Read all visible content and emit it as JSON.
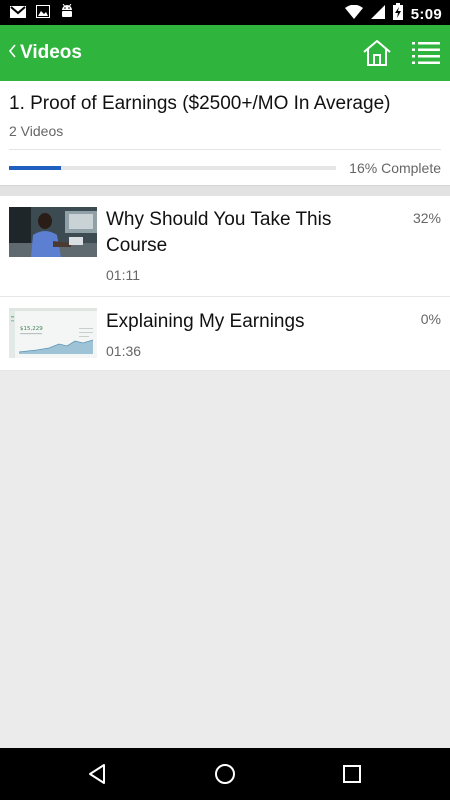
{
  "status_bar": {
    "time": "5:09",
    "icons": [
      "gmail-icon",
      "image-icon",
      "android-icon",
      "wifi-icon",
      "signal-icon",
      "battery-charging-icon"
    ]
  },
  "app_bar": {
    "title": "Videos",
    "back_icon": "chevron-left-icon",
    "home_icon": "home-icon",
    "menu_icon": "list-menu-icon",
    "color": "#2fb53d"
  },
  "section": {
    "title": "1. Proof of Earnings ($2500+/MO In Average)",
    "count_label": "2 Videos",
    "progress_fraction": 0.16,
    "progress_label": "16% Complete",
    "progress_color": "#1e5fbf"
  },
  "videos": [
    {
      "title": "Why Should You Take This Course",
      "duration": "01:11",
      "percent": "32%",
      "thumbnail": "person-at-desk-thumbnail"
    },
    {
      "title": "Explaining My Earnings",
      "duration": "01:36",
      "percent": "0%",
      "thumbnail": "earnings-dashboard-thumbnail",
      "thumbnail_text": "$15,229"
    }
  ],
  "nav_bar": {
    "icons": [
      "back-triangle-icon",
      "home-circle-icon",
      "recents-square-icon"
    ]
  }
}
